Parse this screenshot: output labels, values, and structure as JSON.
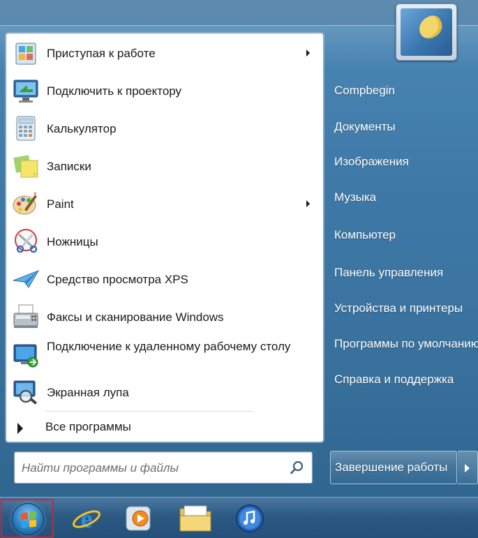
{
  "programs": [
    {
      "label": "Приступая к работе",
      "icon": "getting-started-icon",
      "has_submenu": true
    },
    {
      "label": "Подключить к проектору",
      "icon": "projector-icon",
      "has_submenu": false
    },
    {
      "label": "Калькулятор",
      "icon": "calculator-icon",
      "has_submenu": false
    },
    {
      "label": "Записки",
      "icon": "sticky-notes-icon",
      "has_submenu": false
    },
    {
      "label": "Paint",
      "icon": "paint-palette-icon",
      "has_submenu": true
    },
    {
      "label": "Ножницы",
      "icon": "snipping-scissors-icon",
      "has_submenu": false
    },
    {
      "label": "Средство просмотра XPS",
      "icon": "xps-viewer-icon",
      "has_submenu": false
    },
    {
      "label": "Факсы и сканирование Windows",
      "icon": "fax-scan-icon",
      "has_submenu": false
    },
    {
      "label": "Подключение к удаленному рабочему столу",
      "icon": "remote-desktop-icon",
      "has_submenu": false
    },
    {
      "label": "Экранная лупа",
      "icon": "magnifier-icon",
      "has_submenu": false
    }
  ],
  "all_programs_label": "Все программы",
  "search": {
    "placeholder": "Найти программы и файлы"
  },
  "right_links": [
    "Compbegin",
    "Документы",
    "Изображения",
    "Музыка",
    "Компьютер",
    "Панель управления",
    "Устройства и принтеры",
    "Программы по умолчанию",
    "Справка и поддержка"
  ],
  "shutdown_label": "Завершение работы",
  "taskbar": {
    "start_button": "windows-start-orb",
    "pinned": [
      "internet-explorer-icon",
      "media-player-icon",
      "windows-explorer-icon",
      "itunes-icon"
    ]
  },
  "colors": {
    "start_highlight_border": "#d9202a",
    "menu_blue": "#3f7aa8",
    "panel_bg": "#ffffff"
  }
}
